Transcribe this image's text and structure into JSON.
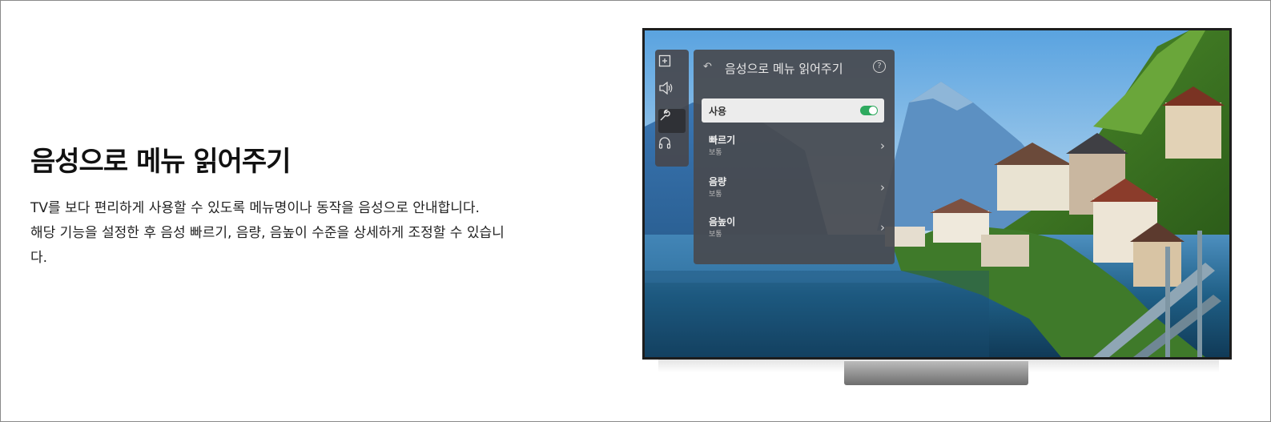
{
  "feature": {
    "title": "음성으로 메뉴 읽어주기",
    "description_lines": [
      "TV를 보다 편리하게 사용할 수 있도록 메뉴명이나 동작을 음성으로 안내합니다.",
      "해당 기능을 설정한 후 음성 빠르기, 음량, 음높이 수준을 상세하게 조정할 수 있습니",
      "다."
    ]
  },
  "tv_menu": {
    "sidebar_icons": [
      {
        "icon": "picture-settings-icon",
        "active": false
      },
      {
        "icon": "speaker-icon",
        "active": false
      },
      {
        "icon": "wrench-icon",
        "active": true
      },
      {
        "icon": "headset-icon",
        "active": false
      }
    ],
    "panel": {
      "back_icon": "back-arrow-icon",
      "title": "음성으로 메뉴 읽어주기",
      "help_icon": "help-icon",
      "help_glyph": "?",
      "toggle": {
        "label": "사용",
        "enabled": true,
        "color": "#2eaa5f"
      },
      "items": [
        {
          "label": "빠르기",
          "value": "보통"
        },
        {
          "label": "음량",
          "value": "보통"
        },
        {
          "label": "음높이",
          "value": "보통"
        }
      ]
    }
  },
  "colors": {
    "toggle_on": "#2eaa5f",
    "panel_bg": "#484a50",
    "heading_text": "#111111"
  }
}
